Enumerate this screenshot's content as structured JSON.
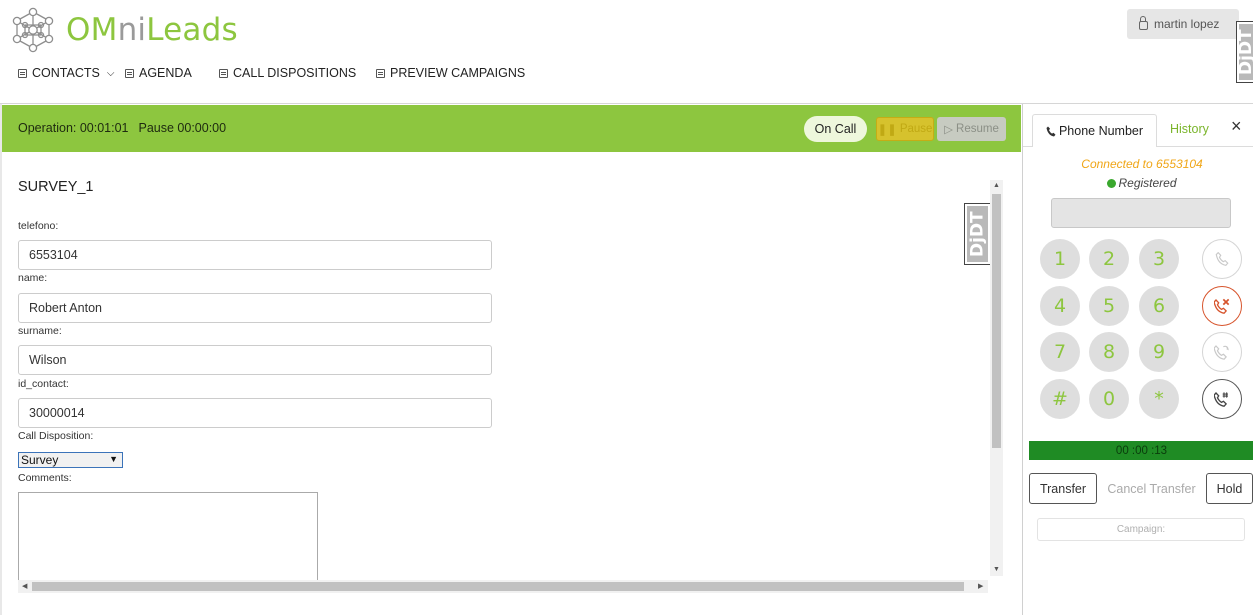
{
  "brand": {
    "om": "OM",
    "ni": "ni",
    "leads": "Leads"
  },
  "nav": {
    "contacts": "CONTACTS",
    "agenda": "AGENDA",
    "call_dispositions": "CALL DISPOSITIONS",
    "preview_campaigns": "PREVIEW CAMPAIGNS"
  },
  "user": {
    "name": "martin lopez"
  },
  "ddt_label": "DjDT",
  "status": {
    "operation": "Operation: 00:01:01",
    "pause": "Pause 00:00:00",
    "on_call": "On Call",
    "pause_btn": "Pause",
    "resume_btn": "Resume"
  },
  "form": {
    "title": "SURVEY_1",
    "fields": [
      {
        "label": "telefono:",
        "value": "6553104"
      },
      {
        "label": "name:",
        "value": "Robert Anton"
      },
      {
        "label": "surname:",
        "value": "Wilson"
      },
      {
        "label": "id_contact:",
        "value": "30000014"
      }
    ],
    "disposition_label": "Call Disposition:",
    "disposition_value": "Survey",
    "comments_label": "Comments:"
  },
  "phone": {
    "tab_phone": "Phone Number",
    "tab_history": "History",
    "close": "×",
    "connected": "Connected to 6553104",
    "registered": "Registered",
    "keys": [
      "1",
      "2",
      "3",
      "4",
      "5",
      "6",
      "7",
      "8",
      "9",
      "#",
      "0",
      "*"
    ],
    "timer": "00 :00 :13",
    "transfer": "Transfer",
    "cancel_transfer": "Cancel Transfer",
    "hold": "Hold",
    "campaign": "Campaign:"
  },
  "colors": {
    "brand_green": "#8dc63f",
    "timer_green": "#1f8b24",
    "hangup_red": "#d7542c",
    "connected_orange": "#f0a617"
  },
  "icons": [
    "logo-network-icon",
    "book-icon",
    "calendar-icon",
    "checklist-icon",
    "list-icon",
    "lock-icon",
    "phone-icon",
    "call-icon",
    "hangup-icon",
    "redial-icon",
    "dtmf-icon"
  ]
}
